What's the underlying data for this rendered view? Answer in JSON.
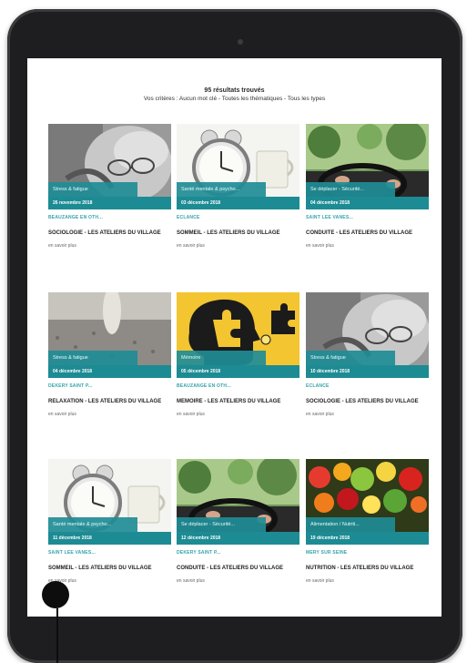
{
  "header": {
    "results_count": "95 résultats trouvés",
    "criteria": "Vos critères : Aucun mot clé - Toutes les thématiques - Tous les types"
  },
  "cards": [
    {
      "tag": "Stress & fatigue",
      "date": "26 novembre 2018",
      "location": "BEAUZANGE EN OTH...",
      "title": "SOCIOLOGIE - LES ATELIERS DU VILLAGE",
      "more": "en savoir plus",
      "image": "elderly-face-glasses"
    },
    {
      "tag": "Santé mentale & psycho...",
      "date": "03 décembre 2018",
      "location": "ECLANCE",
      "title": "SOMMEIL - LES ATELIERS DU VILLAGE",
      "more": "en savoir plus",
      "image": "alarm-clock-mug"
    },
    {
      "tag": "Se déplacer - Sécurité...",
      "date": "04 décembre 2018",
      "location": "SAINT LEE VANES...",
      "title": "CONDUITE - LES ATELIERS DU VILLAGE",
      "more": "en savoir plus",
      "image": "steering-wheel-trees"
    },
    {
      "tag": "Stress & fatigue",
      "date": "04 décembre 2018",
      "location": "DEKERY SAINT P...",
      "title": "RELAXATION - LES ATELIERS DU VILLAGE",
      "more": "en savoir plus",
      "image": "gravel-path-person"
    },
    {
      "tag": "Mémoire",
      "date": "05 décembre 2018",
      "location": "BEAUZANGE EN OTH...",
      "title": "MEMOIRE - LES ATELIERS DU VILLAGE",
      "more": "en savoir plus",
      "image": "puzzle-head"
    },
    {
      "tag": "Stress & fatigue",
      "date": "10 décembre 2018",
      "location": "ECLANCE",
      "title": "SOCIOLOGIE - LES ATELIERS DU VILLAGE",
      "more": "en savoir plus",
      "image": "elderly-face-glasses"
    },
    {
      "tag": "Santé mentale & psycho...",
      "date": "11 décembre 2018",
      "location": "SAINT LEE VANES...",
      "title": "SOMMEIL - LES ATELIERS DU VILLAGE",
      "more": "en savoir plus",
      "image": "alarm-clock-mug"
    },
    {
      "tag": "Se déplacer - Sécurité...",
      "date": "12 décembre 2018",
      "location": "DEKERY SAINT P...",
      "title": "CONDUITE - LES ATELIERS DU VILLAGE",
      "more": "en savoir plus",
      "image": "steering-wheel-trees"
    },
    {
      "tag": "Alimentation / Nutriti...",
      "date": "19 décembre 2018",
      "location": "MERY SUR SEINE",
      "title": "NUTRITION - LES ATELIERS DU VILLAGE",
      "more": "en savoir plus",
      "image": "fruits-vegetables"
    }
  ]
}
